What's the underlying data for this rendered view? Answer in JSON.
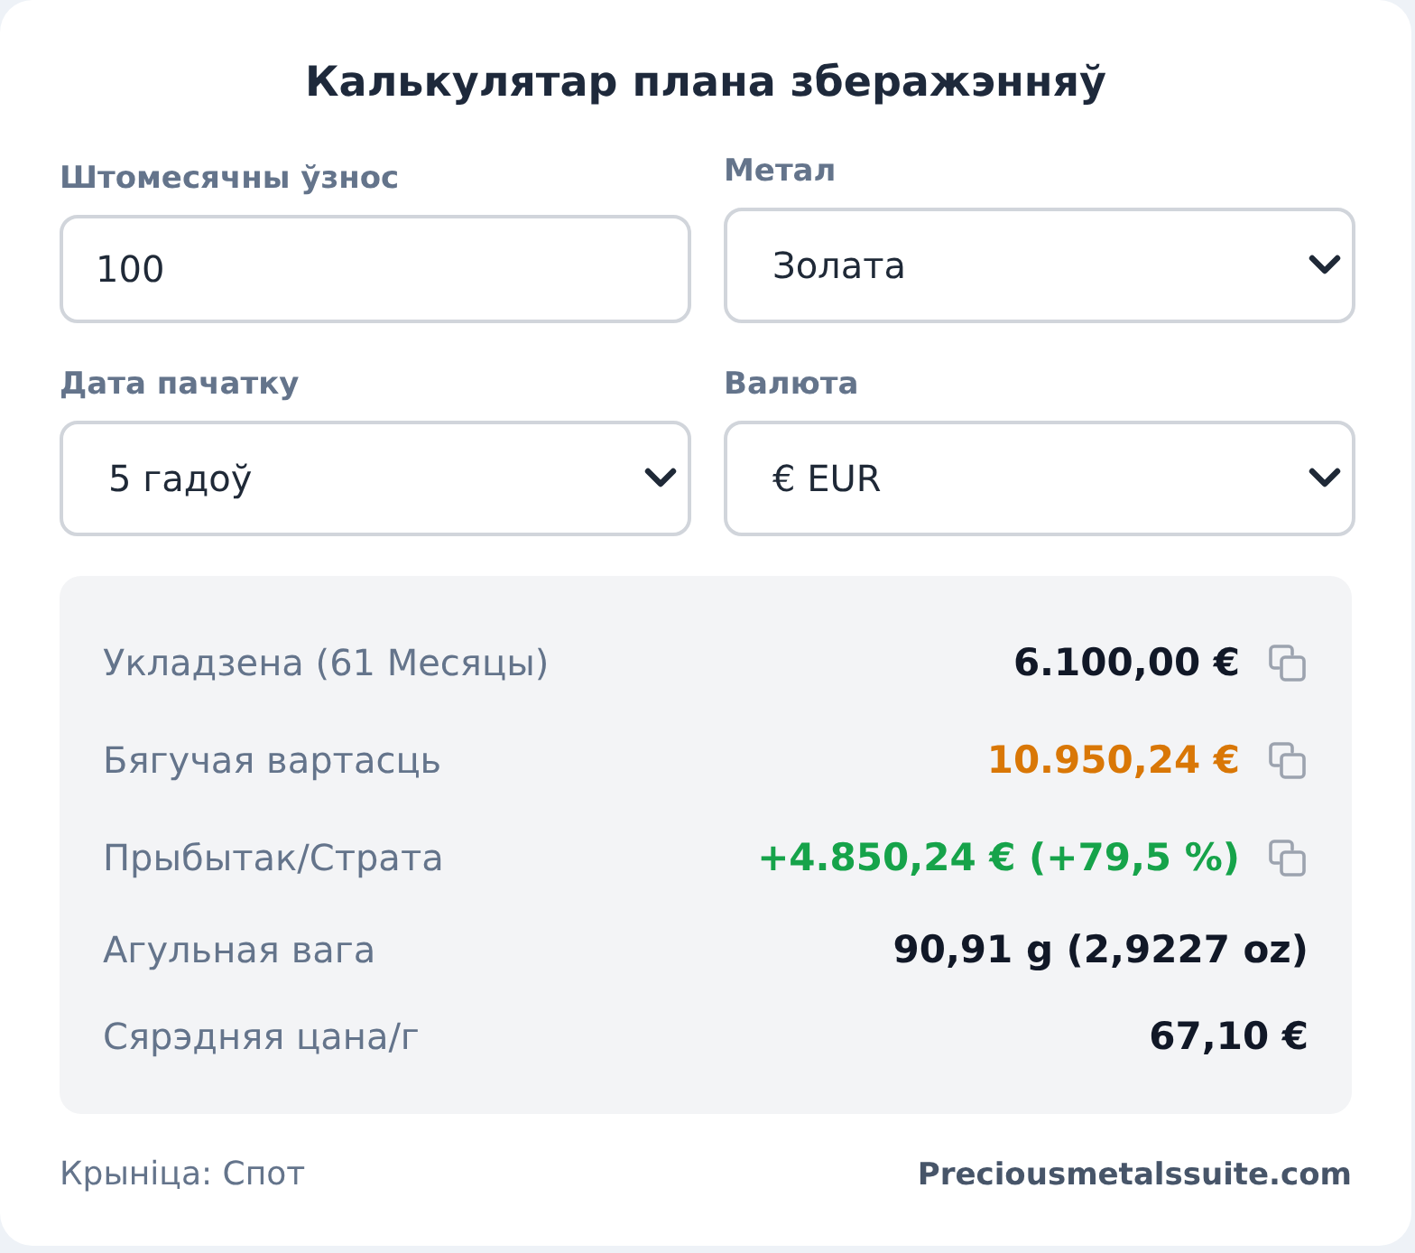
{
  "title": "Калькулятар плана зберажэнняў",
  "fields": [
    {
      "kind": "input",
      "label": "Штомесячны ўзнос",
      "value": "100"
    },
    {
      "kind": "select",
      "label": "Метал",
      "value": "Золата"
    },
    {
      "kind": "select",
      "label": "Дата пачатку",
      "value": "5 гадоў"
    },
    {
      "kind": "select",
      "label": "Валюта",
      "value": "€ EUR"
    }
  ],
  "results": [
    {
      "label": "Укладзена (61 Месяцы)",
      "value": "6.100,00 €",
      "color": "#111827",
      "copyable": true
    },
    {
      "label": "Бягучая вартасць",
      "value": "10.950,24 €",
      "color": "#d97706",
      "copyable": true
    },
    {
      "label": "Прыбытак/Страта",
      "value": "+4.850,24 € (+79,5 %)",
      "color": "#16a34a",
      "copyable": true
    },
    {
      "label": "Агульная вага",
      "value": "90,91 g (2,9227 oz)",
      "color": "#111827",
      "copyable": false
    },
    {
      "label": "Сярэдняя цана/г",
      "value": "67,10 €",
      "color": "#111827",
      "copyable": false
    }
  ],
  "footer": {
    "source": "Крыніца: Спот",
    "site": "Preciousmetalssuite.com"
  }
}
